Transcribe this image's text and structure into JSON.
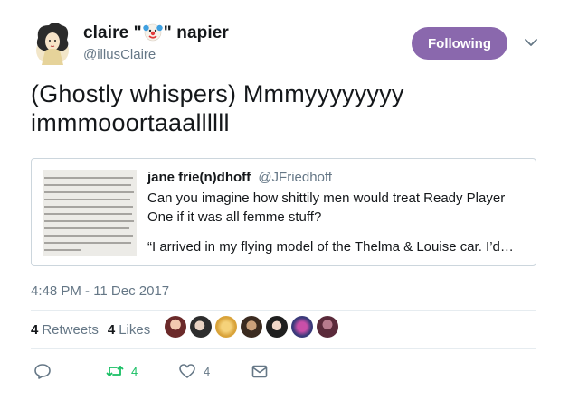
{
  "author": {
    "name_before": "claire \"",
    "name_emoji": "clown-face",
    "name_after": "\" napier",
    "handle": "@illusClaire"
  },
  "follow_button": {
    "label": "Following",
    "color": "#8a68ad"
  },
  "menu": {
    "icon": "chevron-down-icon"
  },
  "tweet": {
    "text": "(Ghostly whispers) Mmmyyyyyyyy immmooortaaallllll"
  },
  "quoted_tweet": {
    "author_name": "jane frie(n)dhoff",
    "author_handle": "@JFriedhoff",
    "text": "Can you imagine how shittily men would treat Ready Player One if it was all femme stuff?",
    "text_continued": "“I arrived in my flying model of the Thelma & Louise car. I’d…"
  },
  "timestamp": "4:48 PM - 11 Dec 2017",
  "stats": {
    "retweets_count": "4",
    "retweets_label": "Retweets",
    "likes_count": "4",
    "likes_label": "Likes",
    "liker_count": 7
  },
  "actions": {
    "reply_icon": "reply-icon",
    "retweet_icon": "retweet-icon",
    "retweet_count": "4",
    "like_icon": "heart-icon",
    "like_count": "4",
    "dm_icon": "envelope-icon"
  },
  "colors": {
    "text": "#14171a",
    "secondary": "#657786",
    "retweet_active": "#17bf63",
    "divider": "#e6ecf0"
  }
}
